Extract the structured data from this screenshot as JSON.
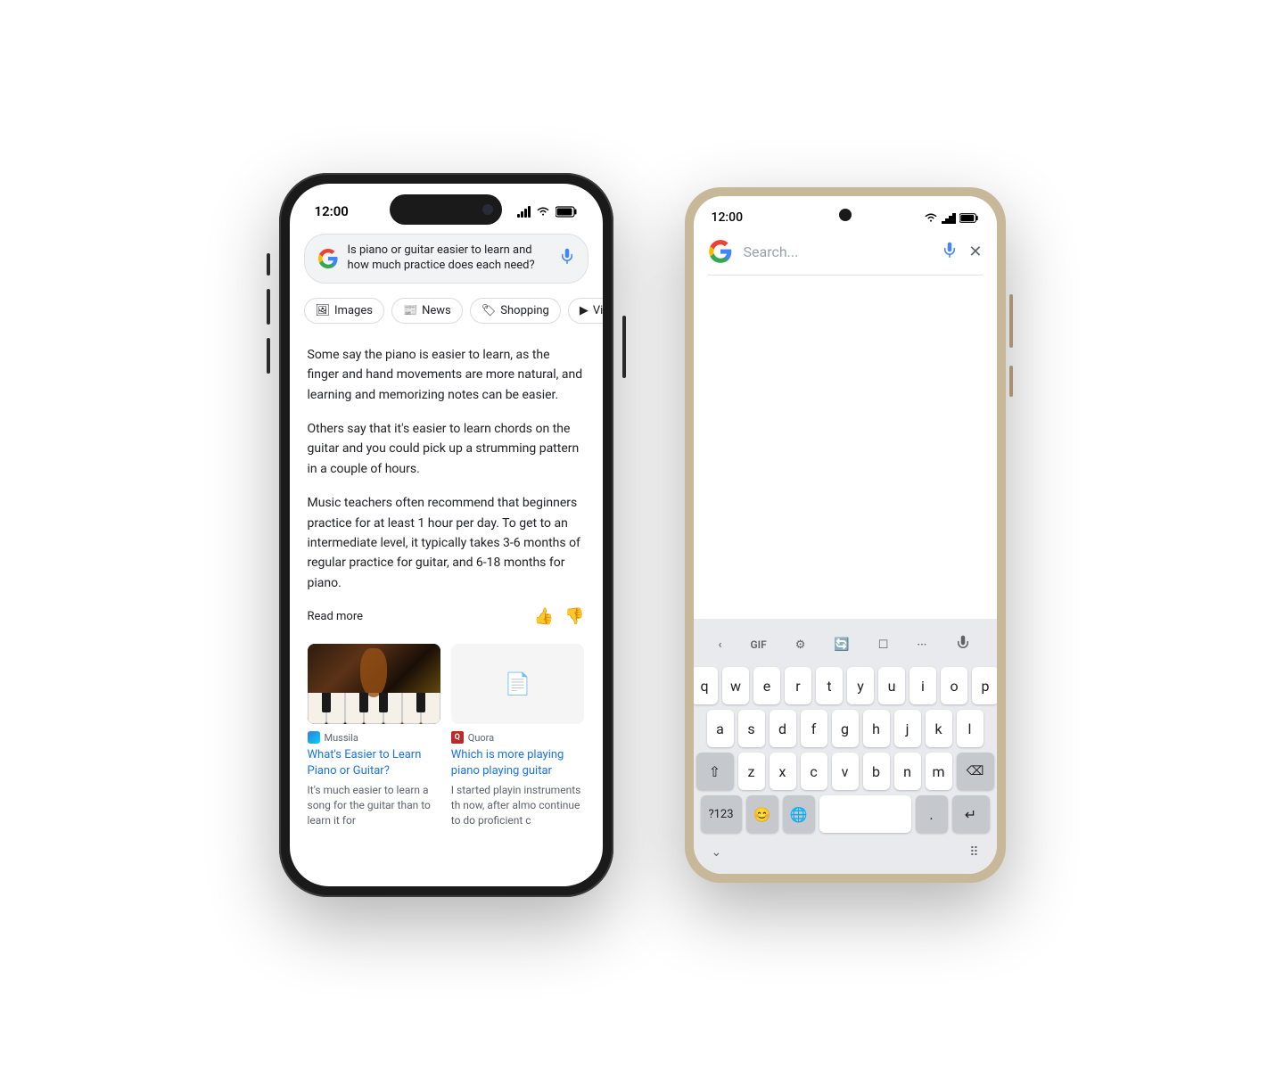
{
  "iphone": {
    "status": {
      "time": "12:00"
    },
    "search": {
      "query": "Is piano or guitar easier to learn and how much practice does each need?",
      "mic_label": "🎤"
    },
    "filter_tabs": [
      {
        "label": "Images",
        "icon": "🖼"
      },
      {
        "label": "News",
        "icon": "📰"
      },
      {
        "label": "Shopping",
        "icon": "🏷"
      },
      {
        "label": "Vide",
        "icon": "▶"
      }
    ],
    "content": {
      "para1": "Some say the piano is easier to learn, as the finger and hand movements are more natural, and learning and memorizing notes can be easier.",
      "para2": "Others say that it's easier to learn chords on the guitar and you could pick up a strumming pattern in a couple of hours.",
      "para3": "Music teachers often recommend that beginners practice for at least 1 hour per day. To get to an intermediate level, it typically takes 3-6 months of regular practice for guitar, and 6-18 months for piano.",
      "read_more": "Read more"
    },
    "articles": [
      {
        "source": "Mussila",
        "title": "What's Easier to Learn Piano or Guitar?",
        "snippet": "It's much easier to learn a song for the guitar than to learn it for"
      },
      {
        "source": "Quora",
        "title": "Which is more playing piano playing guitar",
        "snippet": "I started playin instruments th now, after almo continue to do proficient c"
      }
    ]
  },
  "android": {
    "status": {
      "time": "12:00"
    },
    "search": {
      "placeholder": "Search..."
    },
    "keyboard": {
      "toolbar": [
        "<",
        "GIF",
        "⚙",
        "🔄",
        "☐",
        "···",
        "🎤"
      ],
      "row1": [
        "q",
        "w",
        "e",
        "r",
        "t",
        "y",
        "u",
        "i",
        "o",
        "p"
      ],
      "row2": [
        "a",
        "s",
        "d",
        "f",
        "g",
        "h",
        "j",
        "k",
        "l"
      ],
      "row3": [
        "z",
        "x",
        "c",
        "v",
        "b",
        "n",
        "m"
      ],
      "bottom": [
        "?123",
        "😊",
        "🌐",
        ".",
        "↵"
      ]
    }
  }
}
